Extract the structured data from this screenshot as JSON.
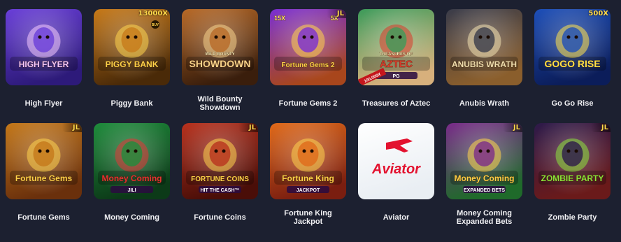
{
  "games": [
    {
      "title": "High Flyer",
      "logo": "HIGH FLYER",
      "bg": [
        "#6a3fd8",
        "#2d1a7a"
      ],
      "accent": "#f3c6ff",
      "badge": ""
    },
    {
      "title": "Piggy Bank",
      "logo": "PIGGY BANK",
      "bg": [
        "#c77a1a",
        "#4a2a08"
      ],
      "accent": "#ffd34a",
      "badge": "13000X",
      "badge_sub": "BUY"
    },
    {
      "title": "Wild Bounty\nShowdown",
      "logo": "SHOWDOWN",
      "logo_top": "WILD BOUNTY",
      "bg": [
        "#b86a28",
        "#3a1e0c"
      ],
      "accent": "#f7d28a",
      "badge": ""
    },
    {
      "title": "Fortune Gems 2",
      "logo": "Fortune Gems 2",
      "bg": [
        "#7a2fd2",
        "#a8461c"
      ],
      "accent": "#ffd24a",
      "badge": "JL",
      "badge_left": "15X",
      "badge_right": "5X"
    },
    {
      "title": "Treasures of Aztec",
      "logo": "AZTEC",
      "logo_top": "TREASURES OF",
      "logo_tag": "PG",
      "logo_side": "100,000X",
      "bg": [
        "#3d9b5a",
        "#d7b07c"
      ],
      "accent": "#d83a2a",
      "badge": ""
    },
    {
      "title": "Anubis Wrath",
      "logo": "ANUBIS WRATH",
      "bg": [
        "#3a3c4a",
        "#8a5e2c"
      ],
      "accent": "#f0e0b0",
      "badge": ""
    },
    {
      "title": "Go Go Rise",
      "logo": "GOGO RISE",
      "bg": [
        "#1e4fb8",
        "#0b1d5a"
      ],
      "accent": "#ffe14a",
      "badge": "500X"
    },
    {
      "title": "Fortune Gems",
      "logo": "Fortune Gems",
      "bg": [
        "#c4781a",
        "#6a300c"
      ],
      "accent": "#ffd24a",
      "badge": "JL"
    },
    {
      "title": "Money Coming",
      "logo": "Money Coming",
      "logo_tag": "JILI",
      "bg": [
        "#1f8c3c",
        "#0c3a18"
      ],
      "accent": "#e23434",
      "badge": ""
    },
    {
      "title": "Fortune Coins",
      "logo": "FORTUNE COINS",
      "logo_tag": "HIT THE CASH™",
      "bg": [
        "#b8321e",
        "#4a0e08"
      ],
      "accent": "#ffd24a",
      "badge": "JL"
    },
    {
      "title": "Fortune King\nJackpot",
      "logo": "Fortune King",
      "logo_tag": "JACKPOT",
      "bg": [
        "#e06a1a",
        "#7a1e10"
      ],
      "accent": "#ffd24a",
      "badge": ""
    },
    {
      "title": "Aviator",
      "logo": "Aviator",
      "bg": [
        "#ffffff",
        "#e9eef3"
      ],
      "accent": "#e3122f",
      "badge": ""
    },
    {
      "title": "Money Coming\nExpanded Bets",
      "logo": "Money Coming",
      "logo_tag": "EXPANDED BETS",
      "bg": [
        "#7a2c8a",
        "#1f6a2a"
      ],
      "accent": "#ffd24a",
      "badge": "JL"
    },
    {
      "title": "Zombie Party",
      "logo": "ZOMBIE PARTY",
      "bg": [
        "#2d1a4a",
        "#6a1a1a"
      ],
      "accent": "#8ae23a",
      "badge": "JL"
    }
  ]
}
